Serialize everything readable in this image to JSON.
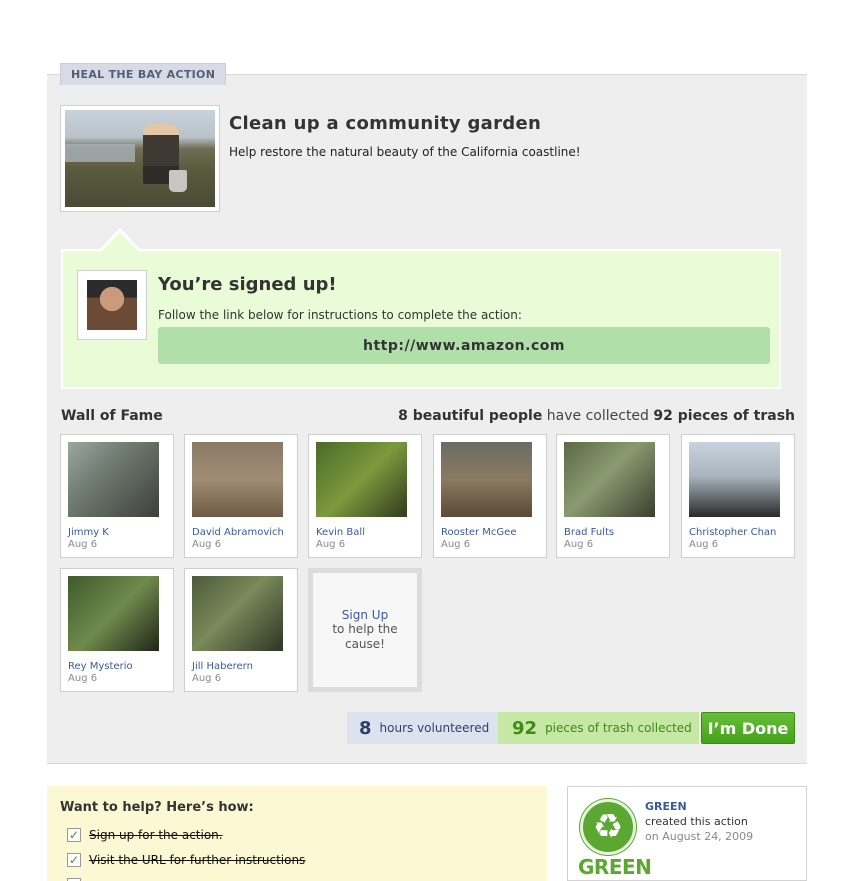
{
  "section_tab": "HEAL THE BAY ACTION",
  "action": {
    "title": "Clean up a community garden",
    "subtitle": "Help restore the natural beauty of the California coastline!"
  },
  "signed_up": {
    "title": "You’re signed up!",
    "instructions": "Follow the link below for instructions to complete the action:",
    "link": "http://www.amazon.com"
  },
  "wall": {
    "title": "Wall of Fame",
    "people_count": "8 beautiful people",
    "mid_text": " have collected ",
    "trash_text": "92 pieces of trash",
    "people": [
      {
        "name": "Jimmy K",
        "date": "Aug 6"
      },
      {
        "name": "David Abramovich",
        "date": "Aug 6"
      },
      {
        "name": "Kevin Ball",
        "date": "Aug 6"
      },
      {
        "name": "Rooster McGee",
        "date": "Aug 6"
      },
      {
        "name": "Brad Fults",
        "date": "Aug 6"
      },
      {
        "name": "Christopher Chan",
        "date": "Aug 6"
      },
      {
        "name": "Rey Mysterio",
        "date": "Aug 6"
      },
      {
        "name": "Jill Haberern",
        "date": "Aug 6"
      }
    ],
    "signup_link": "Sign Up",
    "signup_sub": "to help the cause!"
  },
  "stats": {
    "hours_value": "8",
    "hours_label": "hours volunteered",
    "trash_value": "92",
    "trash_label": "pieces of trash collected",
    "done_label": "I’m Done"
  },
  "help": {
    "title": "Want to help? Here’s how:",
    "steps": [
      {
        "label": "Sign up for the action.",
        "done": true
      },
      {
        "label": "Visit the URL for further instructions",
        "done": true
      }
    ]
  },
  "creator": {
    "logo_text": "GREEN",
    "name": "GREEN",
    "action": "created this action",
    "date": "on August 24, 2009"
  },
  "colors": {
    "panel_bg": "#eeeeef",
    "signed_bg": "#eafbd8",
    "link_bg": "#b1dfa9",
    "done_green": "#4fae24",
    "link_blue": "#3b5998",
    "help_bg": "#fdf8d4"
  }
}
